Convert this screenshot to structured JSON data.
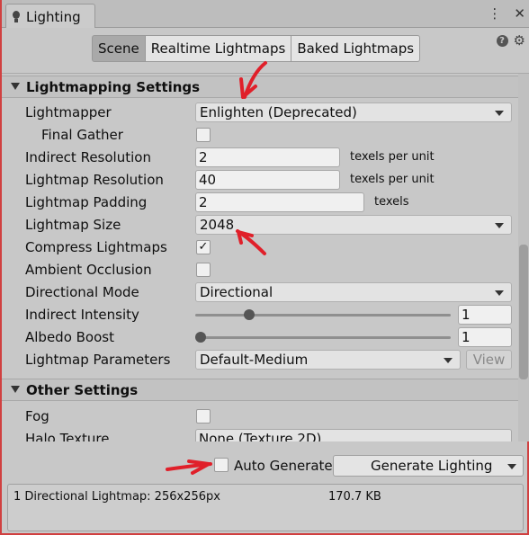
{
  "window": {
    "title": "Lighting",
    "menu_icon": "kebab-menu-icon",
    "close_icon": "close-icon"
  },
  "modes": {
    "tabs": [
      {
        "label": "Scene",
        "active": true
      },
      {
        "label": "Realtime Lightmaps",
        "active": false
      },
      {
        "label": "Baked Lightmaps",
        "active": false
      }
    ],
    "help_icon": "help-icon",
    "settings_icon": "gear-icon"
  },
  "lightmapping": {
    "header": "Lightmapping Settings",
    "lightmapper_label": "Lightmapper",
    "lightmapper_value": "Enlighten (Deprecated)",
    "final_gather_label": "Final Gather",
    "final_gather_checked": false,
    "indirect_resolution_label": "Indirect Resolution",
    "indirect_resolution_value": "2",
    "indirect_resolution_unit": "texels per unit",
    "lightmap_resolution_label": "Lightmap Resolution",
    "lightmap_resolution_value": "40",
    "lightmap_resolution_unit": "texels per unit",
    "lightmap_padding_label": "Lightmap Padding",
    "lightmap_padding_value": "2",
    "lightmap_padding_unit": "texels",
    "lightmap_size_label": "Lightmap Size",
    "lightmap_size_value": "2048",
    "compress_label": "Compress Lightmaps",
    "compress_checked": true,
    "compress_mark": "✓",
    "ao_label": "Ambient Occlusion",
    "ao_checked": false,
    "directional_mode_label": "Directional Mode",
    "directional_mode_value": "Directional",
    "indirect_intensity_label": "Indirect Intensity",
    "indirect_intensity_value": "1",
    "indirect_intensity_slider_fraction": 0.2,
    "albedo_boost_label": "Albedo Boost",
    "albedo_boost_value": "1",
    "albedo_boost_slider_fraction": 0.0,
    "params_label": "Lightmap Parameters",
    "params_value": "Default-Medium",
    "view_label": "View"
  },
  "other": {
    "header": "Other Settings",
    "fog_label": "Fog",
    "fog_checked": false,
    "halo_label": "Halo Texture",
    "halo_value": "None (Texture 2D)"
  },
  "bottom": {
    "auto_generate_label": "Auto Generate",
    "auto_generate_checked": false,
    "generate_label": "Generate Lighting"
  },
  "stats": {
    "summary": "1 Directional Lightmap: 256x256px",
    "size": "170.7 KB"
  },
  "annotation_color": "#e0202a"
}
